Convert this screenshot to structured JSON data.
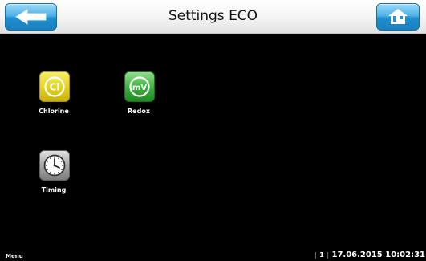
{
  "header": {
    "title": "Settings ECO",
    "back_icon": "back-arrow-icon",
    "home_icon": "home-icon"
  },
  "tiles": [
    {
      "label": "Chlorine",
      "icon": "chlorine-icon",
      "icon_text": "Cl",
      "color": "#e8d41e"
    },
    {
      "label": "Redox",
      "icon": "redox-icon",
      "icon_text": "mV",
      "color": "#3fb13d"
    },
    {
      "label": "Timing",
      "icon": "clock-icon",
      "color": "#a8a8a8"
    }
  ],
  "footer": {
    "menu_label": "Menu",
    "separator": "|",
    "page": "1",
    "datetime": "17.06.2015 10:02:31"
  },
  "colors": {
    "background": "#000000",
    "header": "#f4f4f4",
    "button_blue": "#1f8fcf"
  }
}
